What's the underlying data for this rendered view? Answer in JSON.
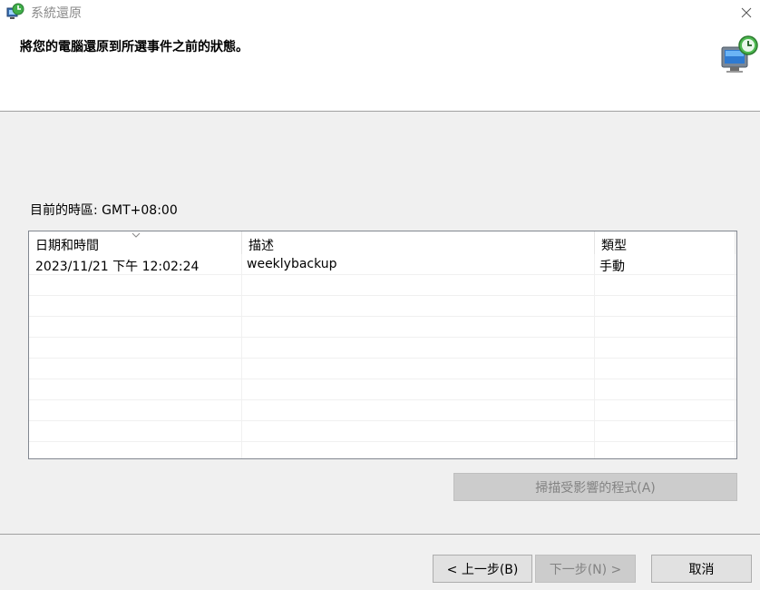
{
  "window": {
    "title": "系統還原",
    "close_icon": "close-icon"
  },
  "header": {
    "instruction": "將您的電腦還原到所選事件之前的狀態。",
    "icon": "system-restore-icon"
  },
  "timezone_label": "目前的時區: GMT+08:00",
  "table": {
    "columns": [
      "日期和時間",
      "描述",
      "類型"
    ],
    "sorted_column": "日期和時間",
    "rows": [
      {
        "datetime": "2023/11/21 下午 12:02:24",
        "description": "weeklybackup",
        "type": "手動"
      }
    ]
  },
  "buttons": {
    "scan": "掃描受影響的程式(A)",
    "back": "< 上一步(B)",
    "next": "下一步(N) >",
    "cancel": "取消"
  }
}
